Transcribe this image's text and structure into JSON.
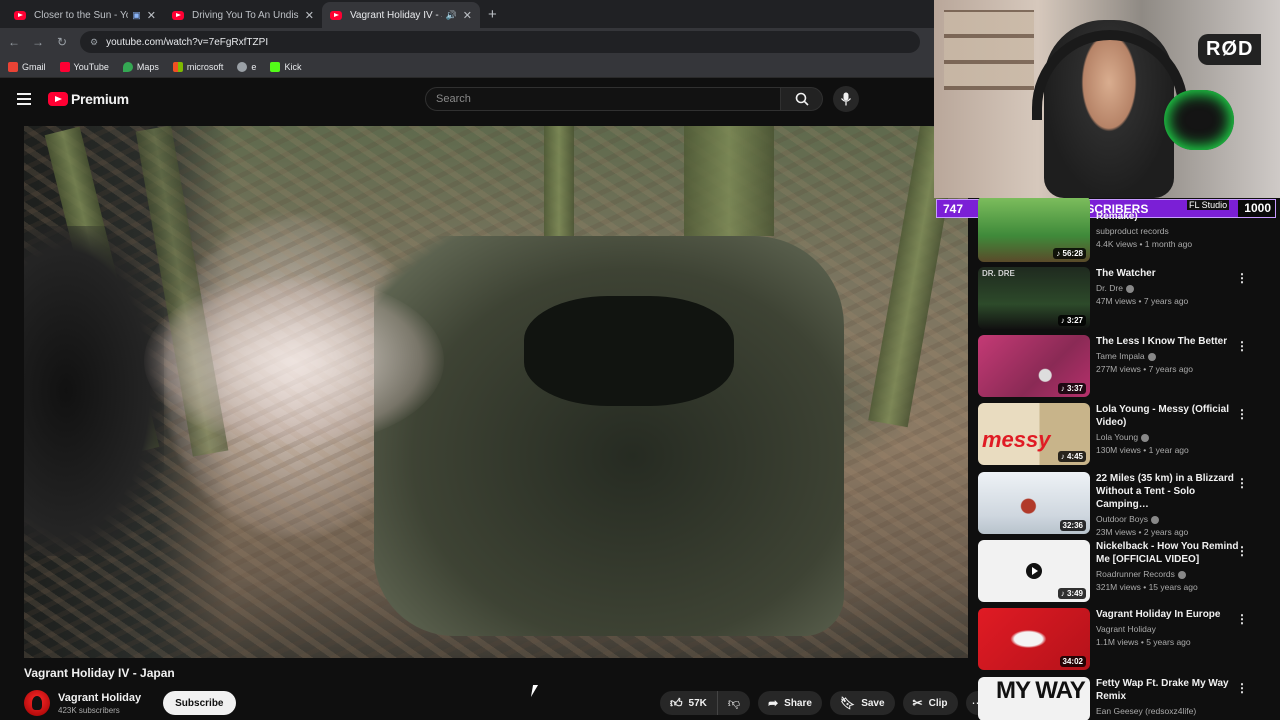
{
  "browser": {
    "tabs": [
      {
        "title": "Closer to the Sun - YouTube"
      },
      {
        "title": "Driving You To An Undisclosed"
      },
      {
        "title": "Vagrant Holiday IV - Japan"
      }
    ],
    "url": "youtube.com/watch?v=7eFgRxfTZPI",
    "bookmarks": [
      {
        "label": "Gmail",
        "color": "#ea4335"
      },
      {
        "label": "YouTube",
        "color": "#ff0033"
      },
      {
        "label": "Maps",
        "color": "#34a853"
      },
      {
        "label": "microsoft",
        "color": "#f25022"
      },
      {
        "label": "e",
        "color": "#9aa0a6"
      },
      {
        "label": "Kick",
        "color": "#53fc18"
      }
    ]
  },
  "masthead": {
    "logo_text": "Premium",
    "search_placeholder": "Search"
  },
  "video": {
    "title": "Vagrant Holiday IV - Japan",
    "channel": "Vagrant Holiday",
    "subscribers": "423K subscribers",
    "subscribe_label": "Subscribe",
    "likes": "57K",
    "share_label": "Share",
    "save_label": "Save",
    "clip_label": "Clip"
  },
  "stream_overlay": {
    "sub_count": "747",
    "label": "SUBSCRIBERS",
    "software": "FL Studio",
    "goal": "1000",
    "mic_brand": "RØD"
  },
  "recommendations": [
    {
      "title": "Remake)",
      "channel": "subproduct records",
      "meta": "4.4K views • 1 month ago",
      "duration": "56:28",
      "thumb_color": "#3f8a3a",
      "verified": false
    },
    {
      "title": "The Watcher",
      "channel": "Dr. Dre",
      "meta": "47M views • 7 years ago",
      "duration": "3:27",
      "thumb_color": "#1f2a1f",
      "thumb_text": "DR. DRE",
      "verified": true
    },
    {
      "title": "The Less I Know The Better",
      "channel": "Tame Impala",
      "meta": "277M views • 7 years ago",
      "duration": "3:37",
      "thumb_color": "#b5306b",
      "verified": true
    },
    {
      "title": "Lola Young - Messy (Official Video)",
      "channel": "Lola Young",
      "meta": "130M views • 1 year ago",
      "duration": "4:45",
      "thumb_color": "#d8c89e",
      "thumb_text": "messy",
      "verified": true
    },
    {
      "title": "22 Miles (35 km) in a Blizzard Without a Tent - Solo Camping…",
      "channel": "Outdoor Boys",
      "meta": "23M views • 2 years ago",
      "duration": "32:36",
      "thumb_color": "#dfe6ee",
      "verified": true
    },
    {
      "title": "Nickelback - How You Remind Me [OFFICIAL VIDEO]",
      "channel": "Roadrunner Records",
      "meta": "321M views • 15 years ago",
      "duration": "3:49",
      "thumb_color": "#eeeeee",
      "verified": true
    },
    {
      "title": "Vagrant Holiday In Europe",
      "channel": "Vagrant Holiday",
      "meta": "1.1M views • 5 years ago",
      "duration": "34:02",
      "thumb_color": "#e01b24",
      "verified": false
    },
    {
      "title": "Fetty Wap Ft. Drake  My Way Remix",
      "channel": "Ean Geesey (redsoxz4life)",
      "meta": "",
      "duration": "",
      "thumb_color": "#f2f2f2",
      "thumb_text": "MY WAY",
      "verified": false
    }
  ]
}
